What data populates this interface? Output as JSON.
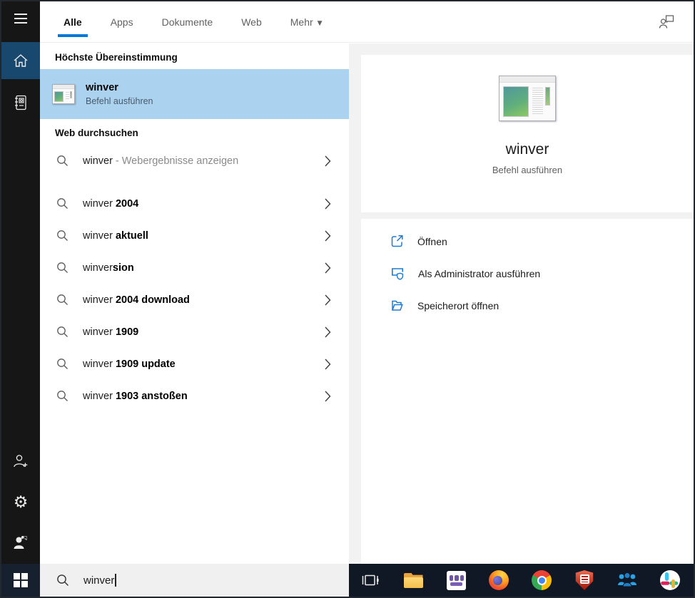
{
  "tabs": {
    "items": [
      {
        "label": "Alle",
        "active": true
      },
      {
        "label": "Apps",
        "active": false
      },
      {
        "label": "Dokumente",
        "active": false
      },
      {
        "label": "Web",
        "active": false
      },
      {
        "label": "Mehr",
        "active": false
      }
    ]
  },
  "best_match": {
    "header": "Höchste Übereinstimmung",
    "title": "winver",
    "subtitle": "Befehl ausführen"
  },
  "web_search": {
    "header": "Web durchsuchen",
    "suggestions": [
      {
        "typed": "winver",
        "completion": "",
        "annotation": "- Webergebnisse anzeigen"
      },
      {
        "typed": "winver ",
        "completion": "2004",
        "annotation": ""
      },
      {
        "typed": "winver ",
        "completion": "aktuell",
        "annotation": ""
      },
      {
        "typed": "winver",
        "completion": "sion",
        "annotation": ""
      },
      {
        "typed": "winver ",
        "completion": "2004 download",
        "annotation": ""
      },
      {
        "typed": "winver ",
        "completion": "1909",
        "annotation": ""
      },
      {
        "typed": "winver ",
        "completion": "1909 update",
        "annotation": ""
      },
      {
        "typed": "winver ",
        "completion": "1903 anstoßen",
        "annotation": ""
      }
    ]
  },
  "preview": {
    "title": "winver",
    "subtitle": "Befehl ausführen",
    "actions": [
      {
        "label": "Öffnen",
        "icon": "open-icon"
      },
      {
        "label": "Als Administrator ausführen",
        "icon": "admin-shield-icon"
      },
      {
        "label": "Speicherort öffnen",
        "icon": "open-location-icon"
      }
    ]
  },
  "search": {
    "value": "winver"
  },
  "sidebar": {
    "icons": [
      "hamburger-menu-icon",
      "home-icon",
      "journal-icon",
      "add-user-icon",
      "settings-gear-icon",
      "share-feedback-icon"
    ]
  },
  "header_icons": {
    "right": "person-feedback-icon"
  },
  "taskbar": {
    "icons": [
      "task-view-icon",
      "file-explorer-icon",
      "purple-app-icon",
      "firefox-icon",
      "chrome-icon",
      "security-shield-icon",
      "people-app-icon",
      "slack-icon"
    ],
    "start": "windows-start-icon"
  },
  "colors": {
    "accent": "#0078d7",
    "selection": "#abd3f0",
    "sidebar_bg": "#161616",
    "home_active_bg": "#19486f",
    "taskbar_bg": "#101825",
    "action_icon_blue": "#1e7ad4"
  }
}
